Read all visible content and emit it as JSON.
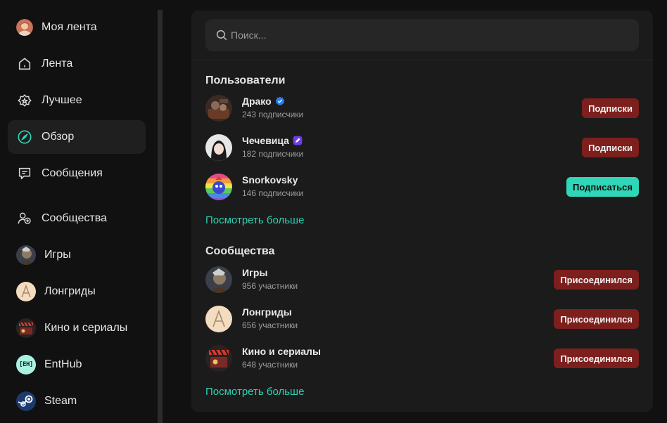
{
  "sidebar": {
    "items": [
      {
        "label": "Моя лента",
        "icon": "avatar"
      },
      {
        "label": "Лента",
        "icon": "home-icon"
      },
      {
        "label": "Лучшее",
        "icon": "star-icon"
      },
      {
        "label": "Обзор",
        "icon": "compass-icon",
        "active": true
      },
      {
        "label": "Сообщения",
        "icon": "message-icon"
      },
      {
        "label": "Сообщества",
        "icon": "users-icon"
      },
      {
        "label": "Игры",
        "icon": "avatar"
      },
      {
        "label": "Лонгриды",
        "icon": "avatar"
      },
      {
        "label": "Кино и сериалы",
        "icon": "avatar"
      },
      {
        "label": "EntHub",
        "icon": "avatar",
        "logo_text": "[EH]"
      },
      {
        "label": "Steam",
        "icon": "avatar"
      }
    ]
  },
  "search": {
    "placeholder": "Поиск...",
    "value": ""
  },
  "users": {
    "title": "Пользователи",
    "items": [
      {
        "name": "Драко",
        "sub": "243 подписчики",
        "button": "Подписки",
        "badge": "verified-blue"
      },
      {
        "name": "Чечевица",
        "sub": "182 подписчики",
        "button": "Подписки",
        "badge": "pen-purple"
      },
      {
        "name": "Snorkovsky",
        "sub": "146 подписчики",
        "button": "Подписаться"
      }
    ],
    "more": "Посмотреть больше"
  },
  "communities": {
    "title": "Сообщества",
    "items": [
      {
        "name": "Игры",
        "sub": "956 участники",
        "button": "Присоединился"
      },
      {
        "name": "Лонгриды",
        "sub": "656 участники",
        "button": "Присоединился"
      },
      {
        "name": "Кино и сериалы",
        "sub": "648 участники",
        "button": "Присоединился"
      }
    ],
    "more": "Посмотреть больше"
  },
  "colors": {
    "accent": "#2fd6b7",
    "joined": "#7d1f1c",
    "panel": "#1b1b1b",
    "bg": "#111111"
  }
}
